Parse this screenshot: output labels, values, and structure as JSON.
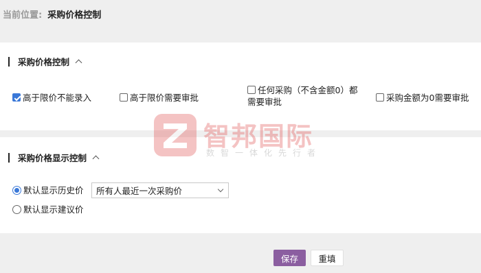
{
  "breadcrumb": {
    "label": "当前位置:",
    "current": "采购价格控制"
  },
  "price_control": {
    "title": "采购价格控制",
    "options": [
      {
        "label": "高于限价不能录入",
        "checked": true
      },
      {
        "label": "高于限价需要审批",
        "checked": false
      },
      {
        "label_line1": "任何采购（不含金额0）都",
        "label_line2": "需要审批",
        "checked": false
      },
      {
        "label": "采购金额为0需要审批",
        "checked": false
      }
    ]
  },
  "price_display": {
    "title": "采购价格显示控制",
    "radios": [
      {
        "label": "默认显示历史价",
        "checked": true
      },
      {
        "label": "默认显示建议价",
        "checked": false
      }
    ],
    "select_value": "所有人最近一次采购价"
  },
  "buttons": {
    "save": "保存",
    "reset": "重填"
  },
  "watermark": {
    "title": "智邦国际",
    "subtitle": "数智一体化先行者"
  },
  "colors": {
    "accent": "#8b5ea0",
    "checkbox": "#3a78d8",
    "watermark": "#e04848"
  }
}
